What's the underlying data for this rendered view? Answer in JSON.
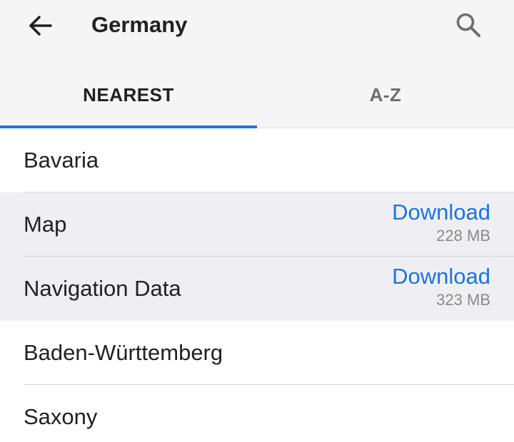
{
  "header": {
    "title": "Germany",
    "back_icon": "arrow-left-icon",
    "search_icon": "search-icon"
  },
  "tabs": [
    {
      "label": "NEAREST",
      "active": true
    },
    {
      "label": "A-Z",
      "active": false
    }
  ],
  "colors": {
    "accent": "#1a73e8",
    "highlight_row": "#efeff3",
    "header_bg": "#f5f5f5"
  },
  "list": {
    "region1": {
      "label": "Bavaria"
    },
    "map": {
      "label": "Map",
      "action": "Download",
      "size": "228 MB"
    },
    "nav": {
      "label": "Navigation Data",
      "action": "Download",
      "size": "323 MB"
    },
    "region2": {
      "label": "Baden-Württemberg"
    },
    "region3": {
      "label": "Saxony"
    }
  }
}
